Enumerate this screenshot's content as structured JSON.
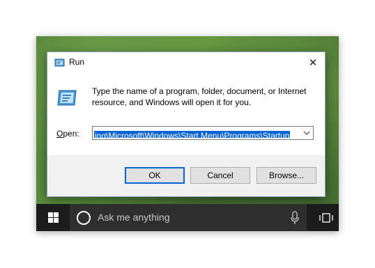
{
  "dialog": {
    "title": "Run",
    "close_glyph": "✕",
    "description": "Type the name of a program, folder, document, or Internet resource, and Windows will open it for you.",
    "open_label_underlined": "O",
    "open_label_rest": "pen:",
    "open_value": "ing\\Microsoft\\Windows\\Start Menu\\Programs\\Startup",
    "buttons": {
      "ok": "OK",
      "cancel": "Cancel",
      "browse": "Browse..."
    },
    "icons": {
      "title": "run-icon",
      "body": "run-icon",
      "dropdown": "chevron-down-icon"
    },
    "accent_color": "#0a64d6"
  },
  "taskbar": {
    "search_placeholder": "Ask me anything",
    "icons": {
      "start": "windows-logo-icon",
      "cortana": "cortana-icon",
      "mic": "microphone-icon",
      "task_view": "task-view-icon"
    }
  }
}
